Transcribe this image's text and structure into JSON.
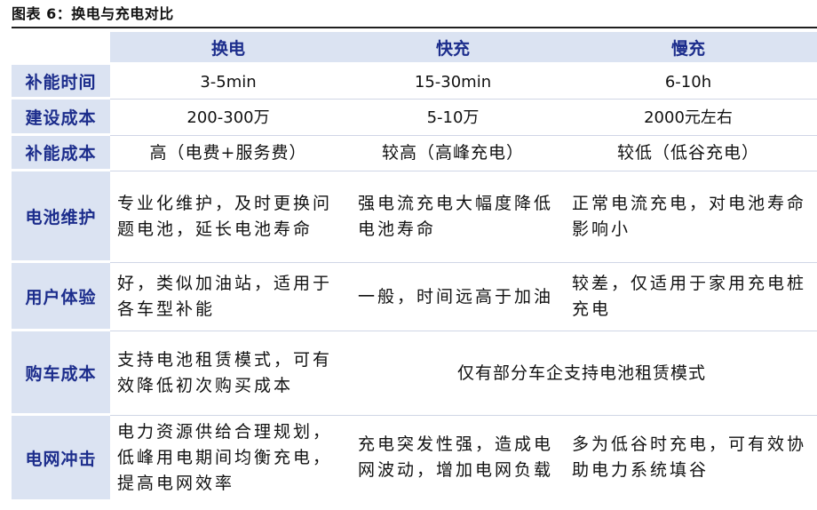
{
  "figure_title": "图表 6：换电与充电对比",
  "columns": [
    "换电",
    "快充",
    "慢充"
  ],
  "rows": [
    {
      "label": "补能时间",
      "cells": [
        "3-5min",
        "15-30min",
        "6-10h"
      ]
    },
    {
      "label": "建设成本",
      "cells": [
        "200-300万",
        "5-10万",
        "2000元左右"
      ]
    },
    {
      "label": "补能成本",
      "cells": [
        "高（电费+服务费）",
        "较高（高峰充电）",
        "较低（低谷充电）"
      ]
    },
    {
      "label": "电池维护",
      "cells": [
        "专业化维护，及时更换问题电池，延长电池寿命",
        "强电流充电大幅度降低电池寿命",
        "正常电流充电，对电池寿命影响小"
      ]
    },
    {
      "label": "用户体验",
      "cells": [
        "好，类似加油站，适用于各车型补能",
        "一般，时间远高于加油",
        "较差，仅适用于家用充电桩充电"
      ]
    },
    {
      "label": "购车成本",
      "cells": [
        "支持电池租赁模式，可有效降低初次购买成本",
        "仅有部分车企支持电池租赁模式"
      ]
    },
    {
      "label": "电网冲击",
      "cells": [
        "电力资源供给合理规划，低峰用电期间均衡充电，提高电网效率",
        "充电突发性强，造成电网波动，增加电网负载",
        "多为低谷时充电，可有效协助电力系统填谷"
      ]
    }
  ]
}
